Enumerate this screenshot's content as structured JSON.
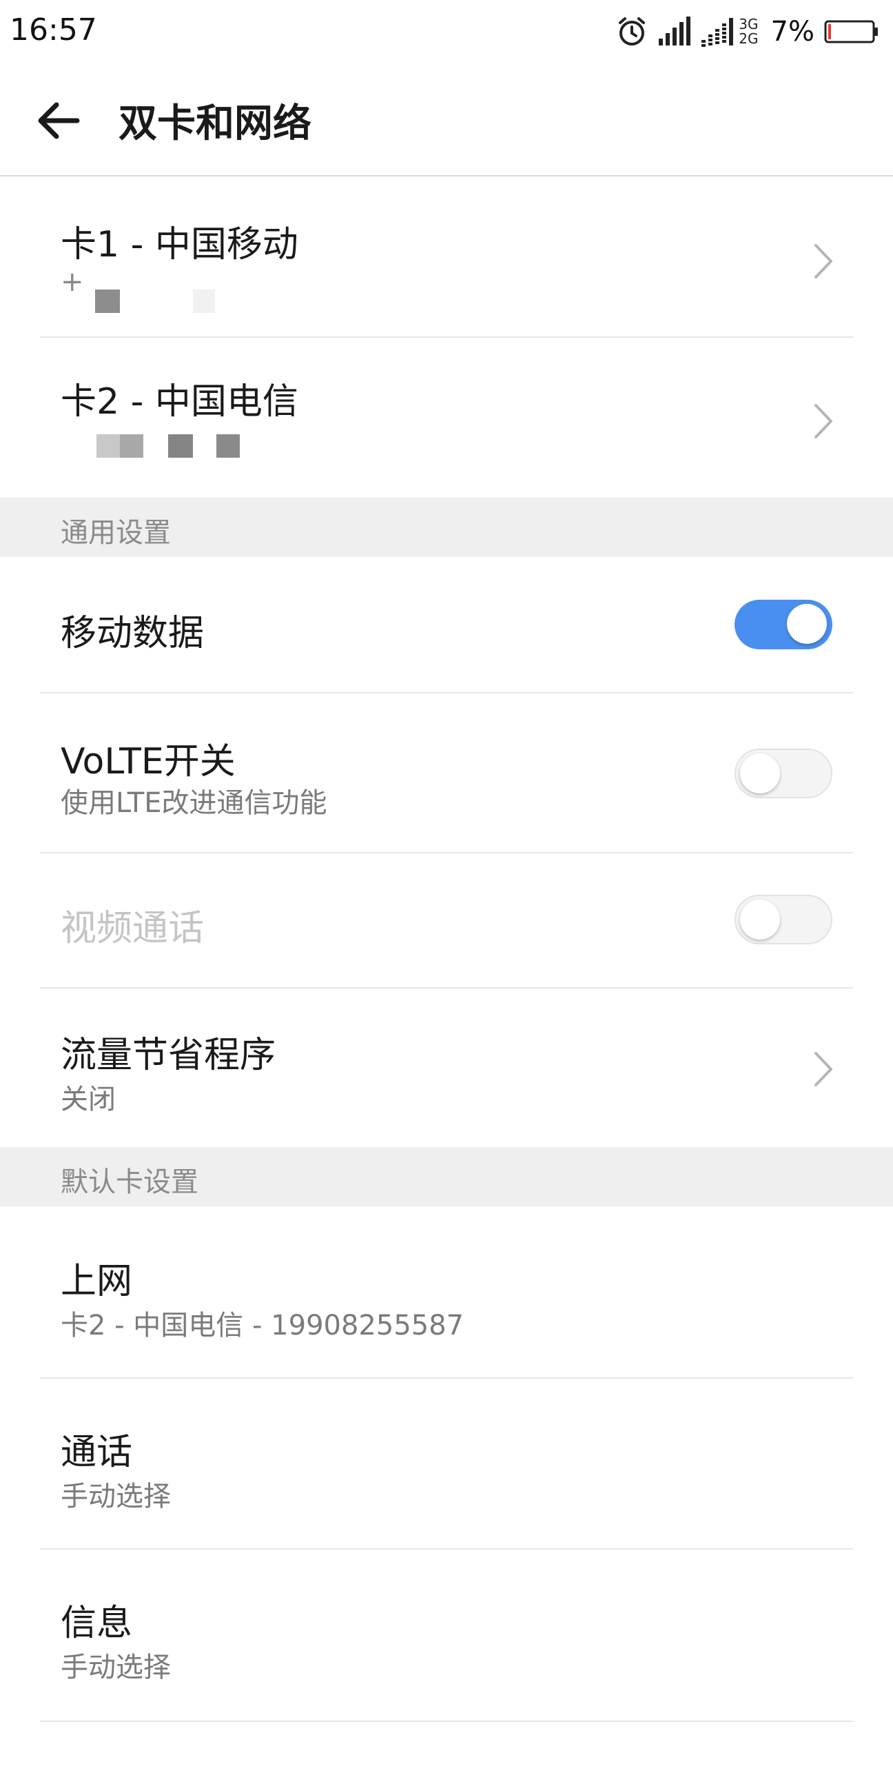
{
  "status_bar": {
    "time": "16:57",
    "network_top": "3G",
    "network_bottom": "2G",
    "battery_percent": "7%",
    "battery_level": 0.07,
    "battery_color": "#e53935",
    "icons": [
      "alarm-icon",
      "signal-icon",
      "signal-icon",
      "battery-icon"
    ]
  },
  "header": {
    "title": "双卡和网络",
    "back_icon": "arrow-left-icon"
  },
  "sim_cards": [
    {
      "title": "卡1 - 中国移动",
      "subtitle": "+"
    },
    {
      "title": "卡2 - 中国电信",
      "subtitle": ""
    }
  ],
  "general": {
    "section_title": "通用设置",
    "mobile_data": {
      "title": "移动数据",
      "enabled": true
    },
    "volte": {
      "title": "VoLTE开关",
      "subtitle": "使用LTE改进通信功能",
      "enabled": false
    },
    "video_call": {
      "title": "视频通话",
      "enabled": false,
      "disabled": true
    },
    "data_saver": {
      "title": "流量节省程序",
      "subtitle": "关闭"
    }
  },
  "default_card": {
    "section_title": "默认卡设置",
    "internet": {
      "title": "上网",
      "subtitle": "卡2 - 中国电信 - 19908255587"
    },
    "calls": {
      "title": "通话",
      "subtitle": "手动选择"
    },
    "messages": {
      "title": "信息",
      "subtitle": "手动选择"
    }
  },
  "colors": {
    "accent": "#4a8ff0",
    "section_bg": "#efefef",
    "divider": "#e6e6e6"
  }
}
